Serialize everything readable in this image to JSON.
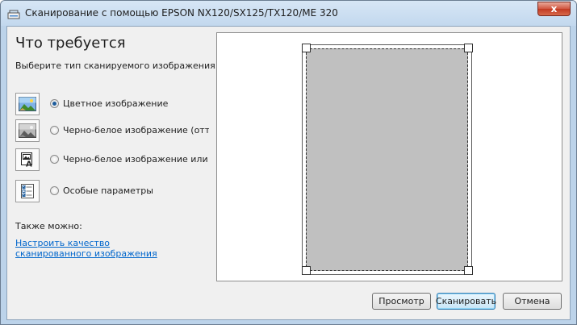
{
  "window": {
    "title": "Сканирование с помощью EPSON NX120/SX125/TX120/ME 320",
    "close_label": "x"
  },
  "main": {
    "heading": "Что требуется",
    "subtitle": "Выберите тип сканируемого изображения.",
    "options": [
      {
        "label": "Цветное изображение",
        "checked": true,
        "icon": "color-photo-icon"
      },
      {
        "label": "Черно-белое изображение (оттенки серого)",
        "checked": false,
        "icon": "grayscale-photo-icon"
      },
      {
        "label": "Черно-белое изображение или текст",
        "checked": false,
        "icon": "text-image-icon"
      },
      {
        "label": "Особые параметры",
        "checked": false,
        "icon": "custom-settings-icon"
      }
    ],
    "also_label": "Также можно:",
    "link_text": "Настроить качество сканированного изображения"
  },
  "preview": {
    "scan_area_color": "#c0c0c0"
  },
  "buttons": {
    "preview": "Просмотр",
    "scan": "Сканировать",
    "cancel": "Отмена"
  }
}
